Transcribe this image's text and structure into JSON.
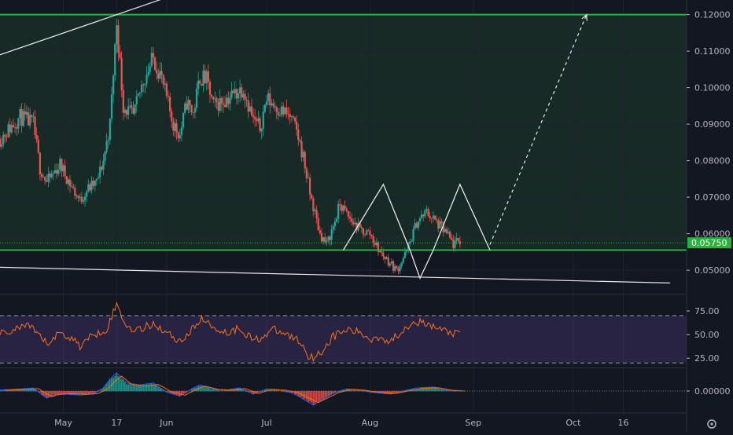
{
  "chart_data": [
    {
      "type": "candlestick",
      "panel": "price",
      "title": "",
      "xlabel": "",
      "ylabel": "",
      "ylim": [
        0.044,
        0.124
      ],
      "y_ticks": [
        0.05,
        0.06,
        0.07,
        0.08,
        0.09,
        0.1,
        0.11,
        0.12
      ],
      "y_tick_labels": [
        "0.05000",
        "0.06000",
        "0.07000",
        "0.08000",
        "0.09000",
        "0.10000",
        "0.11000",
        "0.12000"
      ],
      "x_ticks": [
        {
          "day": 29,
          "label": "May"
        },
        {
          "day": 45,
          "label": "17"
        },
        {
          "day": 60,
          "label": "Jun"
        },
        {
          "day": 90,
          "label": "Jul"
        },
        {
          "day": 121,
          "label": "Aug"
        },
        {
          "day": 152,
          "label": "Sep"
        },
        {
          "day": 182,
          "label": "Oct"
        },
        {
          "day": 197,
          "label": "16"
        }
      ],
      "xlim": [
        10,
        216
      ],
      "current_price": 0.0575,
      "current_price_label": "0.05750",
      "levels": {
        "resistance": 0.12,
        "support": 0.0555
      },
      "price_path": [
        [
          10,
          0.086
        ],
        [
          16,
          0.092
        ],
        [
          20,
          0.09
        ],
        [
          22,
          0.078
        ],
        [
          24,
          0.074
        ],
        [
          28,
          0.079
        ],
        [
          32,
          0.072
        ],
        [
          34,
          0.069
        ],
        [
          36,
          0.072
        ],
        [
          39,
          0.074
        ],
        [
          41,
          0.08
        ],
        [
          43,
          0.09
        ],
        [
          45,
          0.118
        ],
        [
          47,
          0.095
        ],
        [
          50,
          0.092
        ],
        [
          53,
          0.102
        ],
        [
          56,
          0.108
        ],
        [
          58,
          0.104
        ],
        [
          60,
          0.097
        ],
        [
          62,
          0.09
        ],
        [
          64,
          0.087
        ],
        [
          66,
          0.096
        ],
        [
          68,
          0.093
        ],
        [
          70,
          0.103
        ],
        [
          72,
          0.102
        ],
        [
          74,
          0.095
        ],
        [
          78,
          0.097
        ],
        [
          83,
          0.1
        ],
        [
          86,
          0.091
        ],
        [
          88,
          0.089
        ],
        [
          90,
          0.097
        ],
        [
          94,
          0.094
        ],
        [
          97,
          0.092
        ],
        [
          99,
          0.088
        ],
        [
          101,
          0.081
        ],
        [
          103,
          0.071
        ],
        [
          106,
          0.06
        ],
        [
          108,
          0.057
        ],
        [
          110,
          0.062
        ],
        [
          112,
          0.068
        ],
        [
          115,
          0.064
        ],
        [
          118,
          0.061
        ],
        [
          121,
          0.06
        ],
        [
          124,
          0.055
        ],
        [
          127,
          0.052
        ],
        [
          129,
          0.05
        ],
        [
          132,
          0.055
        ],
        [
          135,
          0.063
        ],
        [
          138,
          0.066
        ],
        [
          141,
          0.063
        ],
        [
          144,
          0.06
        ],
        [
          146,
          0.057
        ],
        [
          148,
          0.058
        ]
      ],
      "annotations": {
        "upper_trendline": [
          [
            10,
            0.109
          ],
          [
            61,
            0.125
          ]
        ],
        "lower_trendline": [
          [
            10,
            0.0508
          ],
          [
            211,
            0.0465
          ]
        ],
        "double_bottom_pattern": [
          [
            113,
            0.0555
          ],
          [
            125,
            0.0735
          ],
          [
            133,
            0.0555
          ],
          [
            136,
            0.0478
          ],
          [
            140,
            0.0555
          ],
          [
            148,
            0.0735
          ],
          [
            157,
            0.0555
          ]
        ],
        "projection_arrow": [
          [
            157,
            0.057
          ],
          [
            186,
            0.12
          ]
        ]
      }
    },
    {
      "type": "line",
      "panel": "rsi",
      "ylim": [
        16,
        90
      ],
      "y_ticks": [
        25,
        50,
        75
      ],
      "y_tick_labels": [
        "25.00",
        "50.00",
        "75.00"
      ],
      "band": [
        20,
        70
      ],
      "series": [
        {
          "values": [
            [
              10,
              50
            ],
            [
              14,
              55
            ],
            [
              18,
              60
            ],
            [
              22,
              48
            ],
            [
              24,
              40
            ],
            [
              28,
              52
            ],
            [
              32,
              45
            ],
            [
              34,
              38
            ],
            [
              38,
              50
            ],
            [
              42,
              56
            ],
            [
              45,
              82
            ],
            [
              48,
              58
            ],
            [
              52,
              55
            ],
            [
              56,
              62
            ],
            [
              60,
              52
            ],
            [
              64,
              43
            ],
            [
              68,
              56
            ],
            [
              70,
              67
            ],
            [
              74,
              58
            ],
            [
              78,
              52
            ],
            [
              82,
              57
            ],
            [
              86,
              44
            ],
            [
              89,
              48
            ],
            [
              92,
              55
            ],
            [
              96,
              50
            ],
            [
              99,
              45
            ],
            [
              101,
              38
            ],
            [
              103,
              25
            ],
            [
              106,
              30
            ],
            [
              110,
              48
            ],
            [
              114,
              55
            ],
            [
              118,
              52
            ],
            [
              121,
              45
            ],
            [
              124,
              48
            ],
            [
              127,
              42
            ],
            [
              130,
              52
            ],
            [
              134,
              65
            ],
            [
              138,
              60
            ],
            [
              142,
              56
            ],
            [
              145,
              52
            ],
            [
              148,
              50
            ]
          ]
        }
      ]
    },
    {
      "type": "histogram",
      "panel": "macd",
      "ylim": [
        -0.012,
        0.012
      ],
      "y_ticks": [
        0
      ],
      "y_tick_labels": [
        "0.00000"
      ],
      "series": [
        {
          "values": [
            [
              10,
              0.0005
            ],
            [
              16,
              0.001
            ],
            [
              20,
              0.0015
            ],
            [
              22,
              -0.001
            ],
            [
              24,
              -0.0035
            ],
            [
              26,
              -0.002
            ],
            [
              30,
              -0.0015
            ],
            [
              34,
              -0.002
            ],
            [
              38,
              -0.0015
            ],
            [
              41,
              0.0015
            ],
            [
              43,
              0.006
            ],
            [
              45,
              0.009
            ],
            [
              48,
              0.004
            ],
            [
              52,
              0.003
            ],
            [
              56,
              0.004
            ],
            [
              60,
              -0.0005
            ],
            [
              64,
              -0.0025
            ],
            [
              68,
              0.0015
            ],
            [
              70,
              0.003
            ],
            [
              74,
              0.001
            ],
            [
              78,
              0.0005
            ],
            [
              82,
              0.0015
            ],
            [
              86,
              -0.0015
            ],
            [
              90,
              0.001
            ],
            [
              94,
              0.0005
            ],
            [
              98,
              -0.001
            ],
            [
              101,
              -0.004
            ],
            [
              104,
              -0.007
            ],
            [
              107,
              -0.004
            ],
            [
              110,
              -0.001
            ],
            [
              114,
              0.001
            ],
            [
              118,
              0.0005
            ],
            [
              121,
              -0.0005
            ],
            [
              124,
              -0.001
            ],
            [
              127,
              -0.0015
            ],
            [
              131,
              0
            ],
            [
              135,
              0.0015
            ],
            [
              140,
              0.002
            ],
            [
              144,
              0.0005
            ],
            [
              148,
              0
            ]
          ]
        }
      ]
    }
  ]
}
